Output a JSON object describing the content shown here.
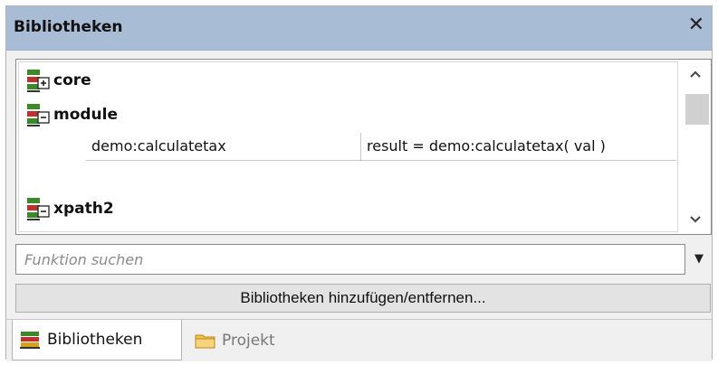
{
  "window": {
    "title": "Bibliotheken",
    "close_glyph": "✕"
  },
  "tree": {
    "libraries": [
      {
        "label": "core",
        "state": "collapsed",
        "icon": "library-collapsed-icon"
      },
      {
        "label": "module",
        "state": "expanded",
        "icon": "library-expanded-icon"
      },
      {
        "label": "xpath2",
        "state": "expanded",
        "icon": "library-expanded-icon"
      }
    ],
    "functions": [
      {
        "name": "demo:calculatetax",
        "signature": "result = demo:calculatetax( val )"
      }
    ]
  },
  "scrollbar": {
    "up_glyph": "⌃",
    "down_glyph": "⌄"
  },
  "search": {
    "placeholder": "Funktion suchen",
    "value": "",
    "dropdown_glyph": "▼"
  },
  "buttons": {
    "add_remove_label": "Bibliotheken hinzufügen/entfernen..."
  },
  "tabs": [
    {
      "label": "Bibliotheken",
      "active": true,
      "icon": "books-icon"
    },
    {
      "label": "Projekt",
      "active": false,
      "icon": "folder-icon"
    }
  ],
  "colors": {
    "titlebar": "#a8bcd6",
    "icon_green": "#3a8a2a",
    "icon_red": "#c03030",
    "folder_yellow": "#f2c14e"
  }
}
